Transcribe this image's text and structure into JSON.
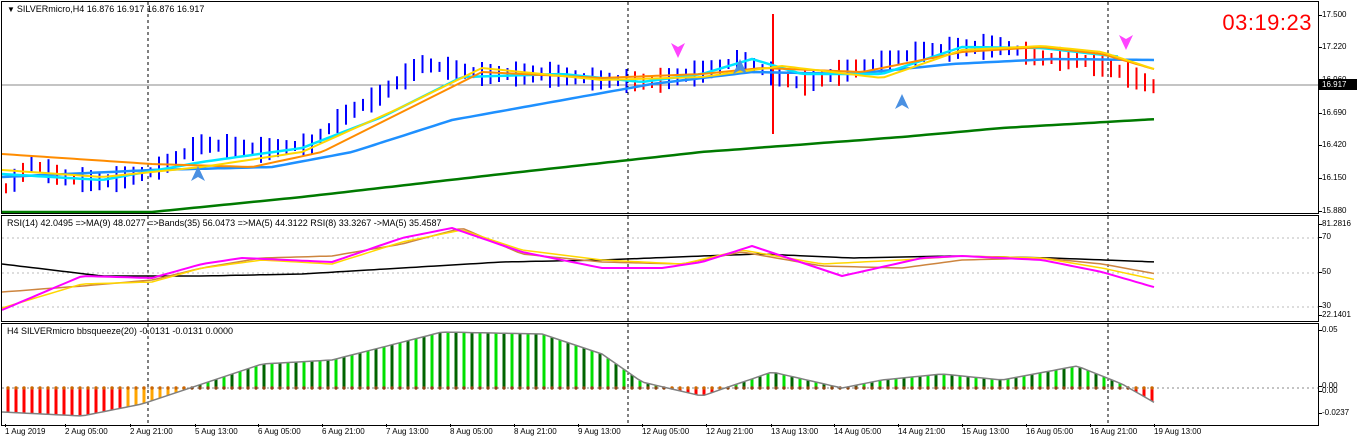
{
  "main_pane": {
    "label": "SILVERmicro,H4  16.876 16.917 16.876 16.917",
    "clock": "03:19:23",
    "current_price": "16.917",
    "price_ticks": [
      "17.500",
      "17.220",
      "16.960",
      "16.690",
      "16.420",
      "16.150",
      "15.880"
    ]
  },
  "rsi_pane": {
    "label": "RSI(14) 42.0495  =>MA(9) 48.0277  =>Bands(35) 56.0473  =>MA(5) 44.3122  RSI(8) 33.3267  ->MA(5) 35.4587",
    "ticks": [
      "81.2816",
      "70",
      "50",
      "30",
      "22.1401"
    ]
  },
  "squeeze_pane": {
    "label": "H4 SILVERmicro bbsqueeze(20) -0.0131 -0.0131 0.0000",
    "ticks": [
      "0.05",
      "0.00",
      "0.00",
      "-0.0237"
    ]
  },
  "time_axis": [
    "1 Aug 2019",
    "2 Aug 05:00",
    "2 Aug 21:00",
    "5 Aug 13:00",
    "6 Aug 05:00",
    "6 Aug 21:00",
    "7 Aug 13:00",
    "8 Aug 05:00",
    "8 Aug 21:00",
    "9 Aug 13:00",
    "12 Aug 05:00",
    "12 Aug 21:00",
    "13 Aug 13:00",
    "14 Aug 05:00",
    "14 Aug 21:00",
    "15 Aug 13:00",
    "16 Aug 05:00",
    "16 Aug 21:00",
    "19 Aug 13:00"
  ],
  "colors": {
    "bull_bar": "#0000ff",
    "bear_bar": "#ff0000",
    "ma_fast": "#00e5ff",
    "ma_mid": "#1e90ff",
    "ma_orange": "#ff8c00",
    "ma_yellow": "#ffd700",
    "ma_slow": "#007a00",
    "rsi_magenta": "#ff00ff",
    "rsi_yellow": "#ffd700",
    "rsi_brown": "#cd853f",
    "rsi_black": "#000000",
    "sq_dark": "#006400",
    "sq_light": "#00e000",
    "sq_red": "#ff0000",
    "sq_orange": "#ffa500",
    "sq_line": "#808080",
    "clock": "#ff0000",
    "arrow_up": "#4a90e2",
    "arrow_down": "#ff44ff"
  }
}
